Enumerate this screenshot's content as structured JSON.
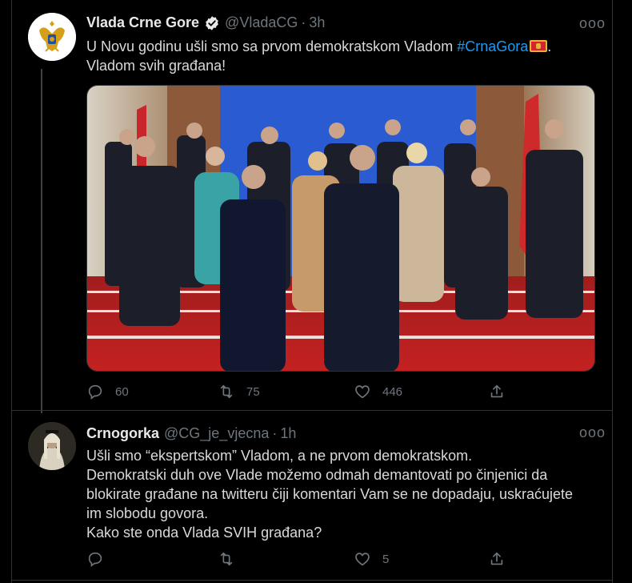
{
  "tweet1": {
    "name": "Vlada Crne Gore",
    "handle": "@VladaCG",
    "separator": "·",
    "time": "3h",
    "more": "ooo",
    "text_line1_prefix": "U Novu godinu ušli smo sa prvom demokratskom Vladom ",
    "hashtag": "#CrnaGora",
    "text_line1_suffix": ".",
    "text_line2": "Vladom svih građana!",
    "replies": "60",
    "retweets": "75",
    "likes": "446",
    "photo_alt": "Group photo of government members standing on red steps in front of a blue wall with flags"
  },
  "tweet2": {
    "name": "Crnogorka",
    "handle": "@CG_je_vjecna",
    "separator": "·",
    "time": "1h",
    "more": "ooo",
    "lines": [
      "Ušli smo “ekspertskom” Vladom, a ne prvom demokratskom.",
      "Demokratski duh ove Vlade možemo odmah demantovati po činjenici da",
      "blokirate građane na twitteru čiji komentari Vam se ne dopadaju, uskraćujete",
      "im slobodu govora.",
      "Kako ste onda Vlada SVIH građana?"
    ],
    "replies": "",
    "retweets": "",
    "likes": "5"
  },
  "colors": {
    "background": "#000000",
    "text": "#d9d9d9",
    "muted": "#6e767d",
    "link": "#1d9bf0",
    "border": "#2f3336"
  }
}
